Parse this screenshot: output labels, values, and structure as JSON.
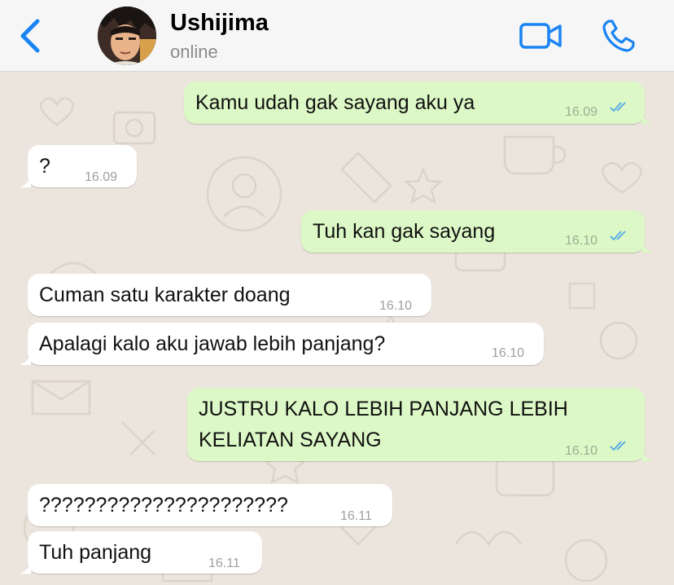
{
  "header": {
    "contact_name": "Ushijima",
    "status": "online",
    "accent_color": "#1a84f4"
  },
  "messages": [
    {
      "direction": "out",
      "lines": [
        "Kamu udah gak sayang aku ya"
      ],
      "time": "16.09",
      "read": true
    },
    {
      "direction": "in",
      "lines": [
        "?"
      ],
      "time": "16.09"
    },
    {
      "direction": "out",
      "lines": [
        "Tuh kan gak sayang"
      ],
      "time": "16.10",
      "read": true
    },
    {
      "direction": "in",
      "lines": [
        "Cuman satu karakter doang"
      ],
      "time": "16.10"
    },
    {
      "direction": "in",
      "lines": [
        "Apalagi kalo aku jawab lebih panjang?"
      ],
      "time": "16.10"
    },
    {
      "direction": "out",
      "lines": [
        "JUSTRU KALO LEBIH PANJANG LEBIH",
        "KELIATAN SAYANG"
      ],
      "time": "16.10",
      "read": true
    },
    {
      "direction": "in",
      "lines": [
        "??????????????????????"
      ],
      "time": "16.11"
    },
    {
      "direction": "in",
      "lines": [
        "Tuh panjang"
      ],
      "time": "16.11"
    }
  ],
  "colors": {
    "outgoing_bubble": "#dcf8c6",
    "incoming_bubble": "#ffffff",
    "chat_background": "#ece5dd",
    "read_ticks": "#4fa8e8"
  }
}
